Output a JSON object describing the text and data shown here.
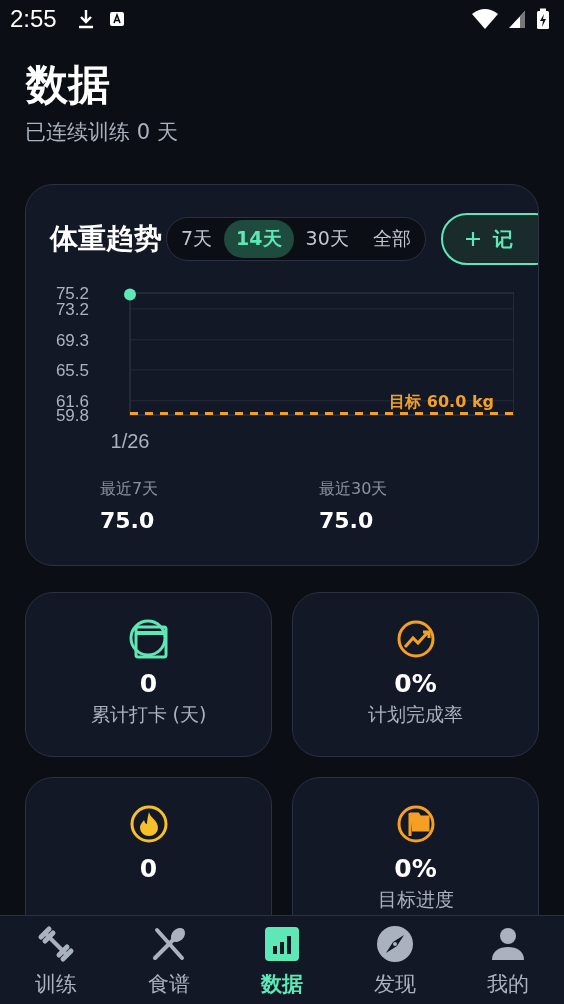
{
  "status_bar": {
    "time": "2:55"
  },
  "header": {
    "title": "数据",
    "subtitle": "已连续训练 0 天"
  },
  "weight_card": {
    "title": "体重趋势",
    "ranges": [
      {
        "label": "7天",
        "selected": false
      },
      {
        "label": "14天",
        "selected": true
      },
      {
        "label": "30天",
        "selected": false
      },
      {
        "label": "全部",
        "selected": false
      }
    ],
    "record_button": "记",
    "chart_data": {
      "type": "line",
      "x": [
        "1/26"
      ],
      "series": [
        {
          "color": "#5ee8b5",
          "marker": "circle",
          "values": [
            75.0
          ]
        }
      ],
      "ylim": [
        59.8,
        75.2
      ],
      "yticks": [
        75.2,
        73.2,
        69.3,
        65.5,
        61.6,
        59.8
      ],
      "grid": true,
      "ref_lines": [
        {
          "axis": "y",
          "value": 60.0,
          "label": "目标 60.0 kg",
          "color": "#f5a023"
        }
      ]
    },
    "stats": [
      {
        "label": "最近7天",
        "value": "75.0"
      },
      {
        "label": "最近30天",
        "value": "75.0"
      }
    ]
  },
  "tiles": [
    {
      "kind": "calendar",
      "value": "0",
      "label": "累计打卡 (天)"
    },
    {
      "kind": "trend",
      "value": "0%",
      "label": "计划完成率"
    },
    {
      "kind": "flame",
      "value": "0"
    },
    {
      "kind": "flag",
      "value": "0%",
      "label": "目标进度"
    }
  ],
  "nav": [
    {
      "kind": "dumbbell",
      "label": "训练",
      "selected": false
    },
    {
      "kind": "utensils",
      "label": "食谱",
      "selected": false
    },
    {
      "kind": "chart",
      "label": "数据",
      "selected": true
    },
    {
      "kind": "compass",
      "label": "发现",
      "selected": false
    },
    {
      "kind": "person",
      "label": "我的",
      "selected": false
    }
  ]
}
